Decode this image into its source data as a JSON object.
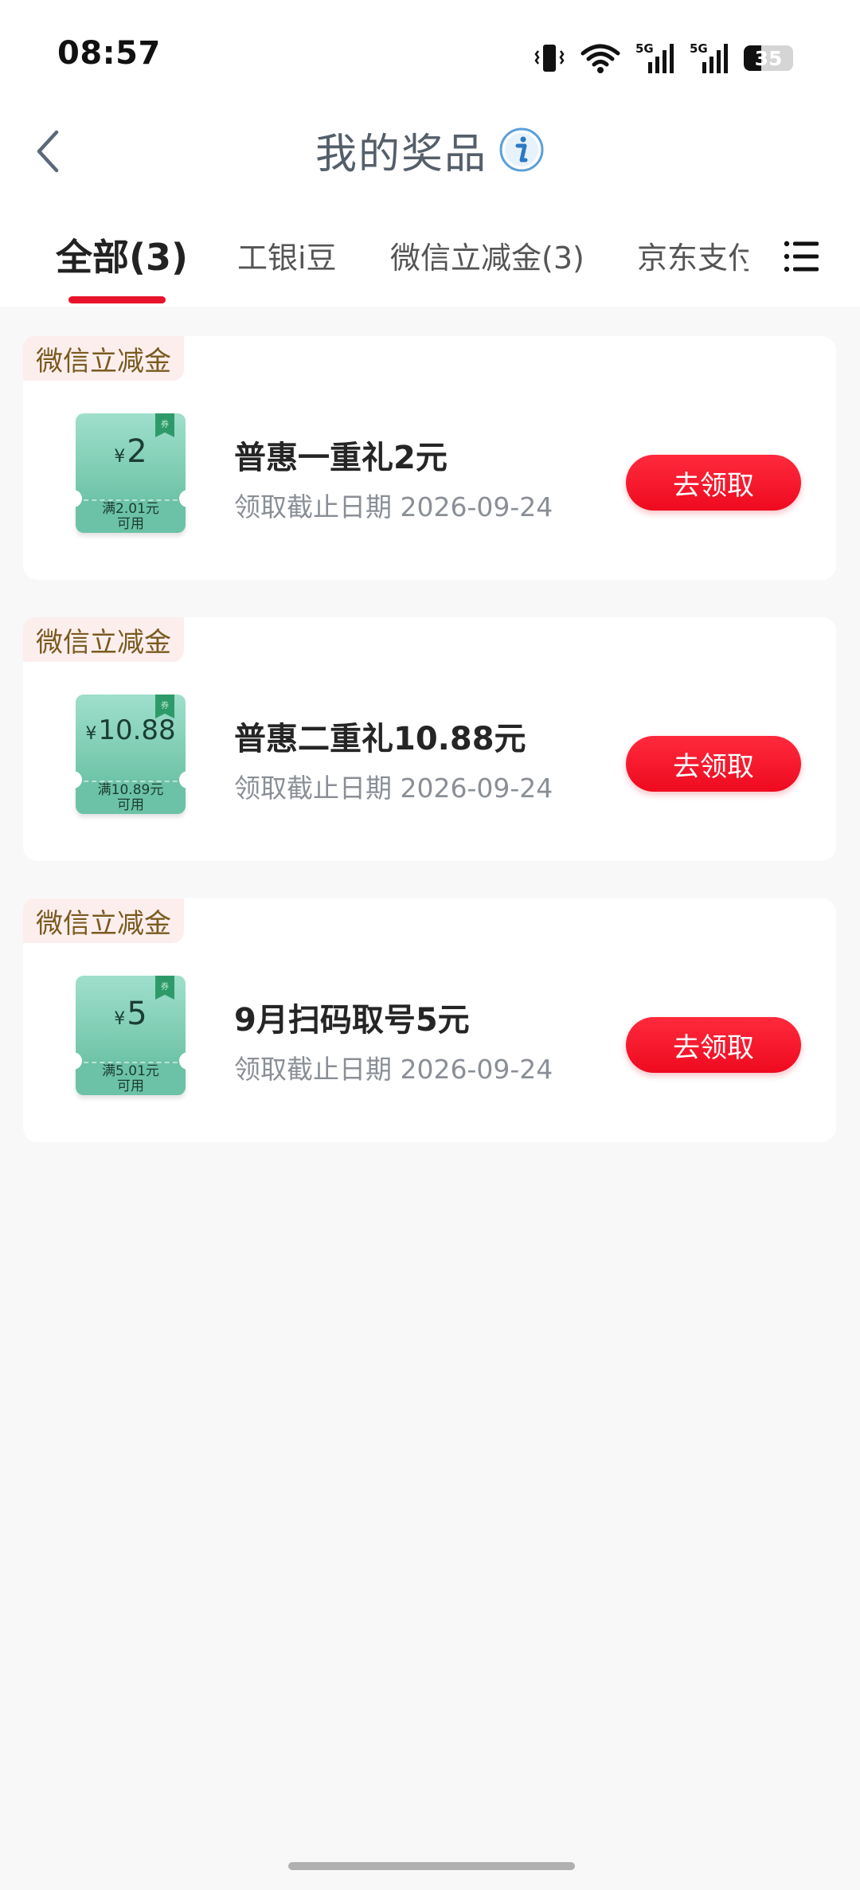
{
  "status_bar": {
    "time": "08:57",
    "battery": "35",
    "icons": [
      "vibrate-icon",
      "wifi-icon",
      "signal-5g-icon",
      "signal-5g-icon",
      "battery-icon"
    ]
  },
  "header": {
    "title": "我的奖品",
    "back_icon": "chevron-left-icon",
    "info_icon": "info-icon"
  },
  "tabs": [
    {
      "label": "全部(3)",
      "active": true
    },
    {
      "label": "工银i豆",
      "active": false
    },
    {
      "label": "微信立减金(3)",
      "active": false
    },
    {
      "label": "京东支付",
      "active": false
    }
  ],
  "menu_icon": "list-menu-icon",
  "colors": {
    "accent": "#e8132b",
    "button": "#ee0a1f",
    "coupon": "#6fc4a8",
    "tag_bg": "#fdeeee",
    "tag_text": "#7a5a1e"
  },
  "cards": [
    {
      "tag": "微信立减金",
      "coupon_yen": "¥",
      "coupon_value": "2",
      "coupon_condition": "满2.01元",
      "coupon_usable": "可用",
      "coupon_flag": "券",
      "name": "普惠一重礼2元",
      "deadline": "领取截止日期 2026-09-24",
      "button": "去领取"
    },
    {
      "tag": "微信立减金",
      "coupon_yen": "¥",
      "coupon_value": "10.88",
      "coupon_condition": "满10.89元",
      "coupon_usable": "可用",
      "coupon_flag": "券",
      "name": "普惠二重礼10.88元",
      "deadline": "领取截止日期 2026-09-24",
      "button": "去领取"
    },
    {
      "tag": "微信立减金",
      "coupon_yen": "¥",
      "coupon_value": "5",
      "coupon_condition": "满5.01元",
      "coupon_usable": "可用",
      "coupon_flag": "券",
      "name": "9月扫码取号5元",
      "deadline": "领取截止日期 2026-09-24",
      "button": "去领取"
    }
  ]
}
